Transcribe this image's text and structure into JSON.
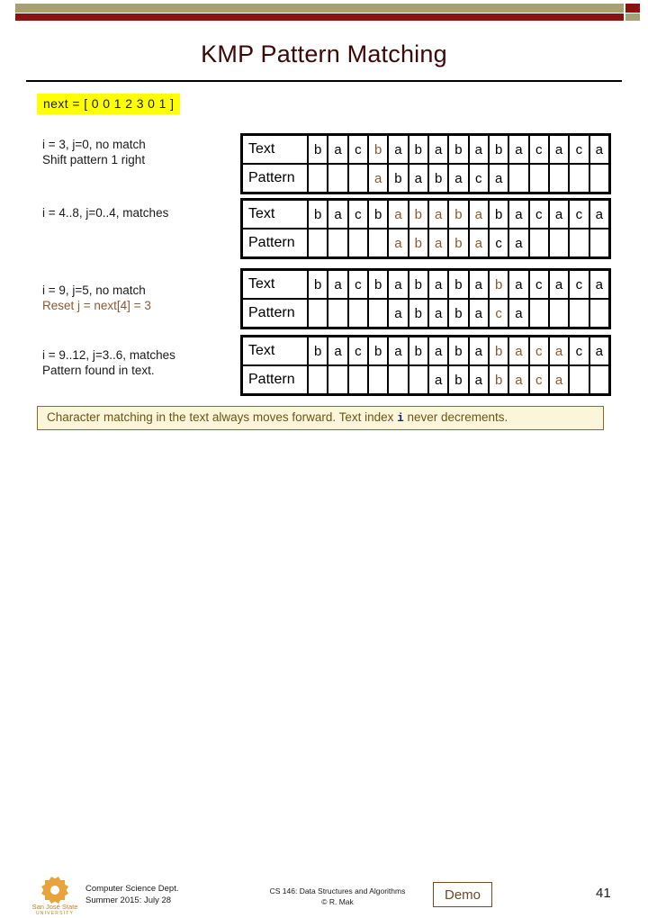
{
  "header": {
    "bar_khaki_color": "#a5a172",
    "bar_red_color": "#8c1111"
  },
  "title": "KMP Pattern Matching",
  "next_array": "next = [ 0 0 1 2 3 0 1 ]",
  "colors": {
    "title": "#3d0808",
    "highlight_char": "#8a5a31",
    "highlight_bg": "#ffff00",
    "note_bg": "#fbf6d9",
    "note_border": "#8a6d1f",
    "note_text": "#6b5418",
    "mono_i": "#12246b",
    "demo_border": "#7a4a1c",
    "logo_gold": "#e8a33d"
  },
  "row_labels": {
    "text": "Text",
    "pattern": "Pattern"
  },
  "steps": [
    {
      "caption_line1": "i = 3, j=0, no match",
      "caption_line2": "Shift pattern 1 right",
      "caption_line2_color": "black",
      "text_cells": [
        "b",
        "a",
        "c",
        "b",
        "a",
        "b",
        "a",
        "b",
        "a",
        "b",
        "a",
        "c",
        "a",
        "c",
        "a"
      ],
      "text_hl": [
        false,
        false,
        false,
        true,
        false,
        false,
        false,
        false,
        false,
        false,
        false,
        false,
        false,
        false,
        false
      ],
      "pattern_cells": [
        "",
        "",
        "",
        "a",
        "b",
        "a",
        "b",
        "a",
        "c",
        "a",
        "",
        "",
        "",
        "",
        ""
      ],
      "pattern_hl": [
        false,
        false,
        false,
        true,
        false,
        false,
        false,
        false,
        false,
        false,
        false,
        false,
        false,
        false,
        false
      ]
    },
    {
      "caption_line1": "i = 4..8, j=0..4, matches",
      "caption_line2": "",
      "caption_line2_color": "black",
      "text_cells": [
        "b",
        "a",
        "c",
        "b",
        "a",
        "b",
        "a",
        "b",
        "a",
        "b",
        "a",
        "c",
        "a",
        "c",
        "a"
      ],
      "text_hl": [
        false,
        false,
        false,
        false,
        true,
        true,
        true,
        true,
        true,
        false,
        false,
        false,
        false,
        false,
        false
      ],
      "pattern_cells": [
        "",
        "",
        "",
        "",
        "a",
        "b",
        "a",
        "b",
        "a",
        "c",
        "a",
        "",
        "",
        "",
        ""
      ],
      "pattern_hl": [
        false,
        false,
        false,
        false,
        true,
        true,
        true,
        true,
        true,
        false,
        false,
        false,
        false,
        false,
        false
      ]
    },
    {
      "caption_line1": "i = 9, j=5, no match",
      "caption_line2": "Reset j = next[4] = 3",
      "caption_line2_color": "brown",
      "text_cells": [
        "b",
        "a",
        "c",
        "b",
        "a",
        "b",
        "a",
        "b",
        "a",
        "b",
        "a",
        "c",
        "a",
        "c",
        "a"
      ],
      "text_hl": [
        false,
        false,
        false,
        false,
        false,
        false,
        false,
        false,
        false,
        true,
        false,
        false,
        false,
        false,
        false
      ],
      "pattern_cells": [
        "",
        "",
        "",
        "",
        "a",
        "b",
        "a",
        "b",
        "a",
        "c",
        "a",
        "",
        "",
        "",
        ""
      ],
      "pattern_hl": [
        false,
        false,
        false,
        false,
        false,
        false,
        false,
        false,
        false,
        true,
        false,
        false,
        false,
        false,
        false
      ]
    },
    {
      "caption_line1": "i = 9..12, j=3..6, matches",
      "caption_line2": "Pattern found in text.",
      "caption_line2_color": "black",
      "text_cells": [
        "b",
        "a",
        "c",
        "b",
        "a",
        "b",
        "a",
        "b",
        "a",
        "b",
        "a",
        "c",
        "a",
        "c",
        "a"
      ],
      "text_hl": [
        false,
        false,
        false,
        false,
        false,
        false,
        false,
        false,
        false,
        true,
        true,
        true,
        true,
        false,
        false
      ],
      "pattern_cells": [
        "",
        "",
        "",
        "",
        "",
        "",
        "a",
        "b",
        "a",
        "b",
        "a",
        "c",
        "a",
        "",
        ""
      ],
      "pattern_hl": [
        false,
        false,
        false,
        false,
        false,
        false,
        false,
        false,
        false,
        true,
        true,
        true,
        true,
        false,
        false
      ]
    }
  ],
  "note": {
    "part1": "Character matching in the text always moves forward. Text index ",
    "mono": "i",
    "part2": " never decrements."
  },
  "footer": {
    "logo_name": "San José State",
    "logo_university": "UNIVERSITY",
    "dept_line1": "Computer Science Dept.",
    "dept_line2": "Summer 2015: July 28",
    "course_line1": "CS 146: Data Structures and Algorithms",
    "course_line2": "© R. Mak",
    "demo_label": "Demo",
    "page_number": "41"
  }
}
